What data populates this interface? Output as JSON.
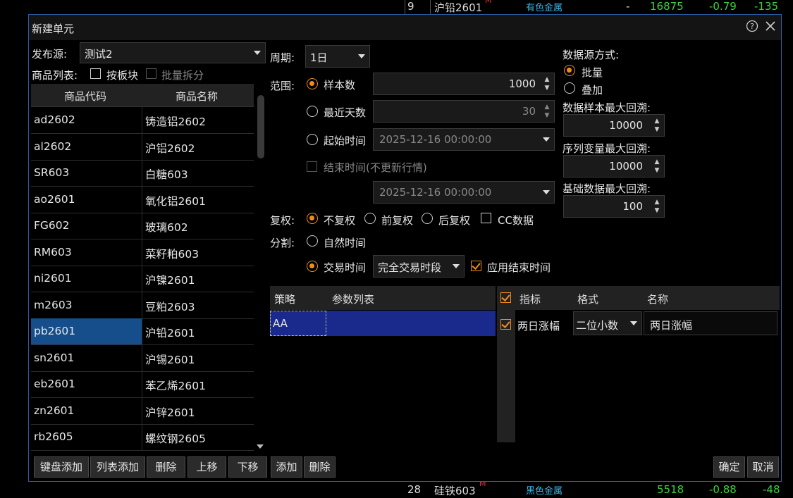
{
  "background_rows": [
    {
      "idx": "9",
      "name": "沪铅2601",
      "mark": "M",
      "sector": "有色金属",
      "c1": "-",
      "price": "16875",
      "chg_pct": "-0.79",
      "chg": "-135"
    },
    {
      "idx": "28",
      "name": "硅铁603",
      "mark": "M",
      "sector": "黑色金属",
      "c1": "",
      "price": "5518",
      "chg_pct": "-0.88",
      "chg": "-48"
    }
  ],
  "dialog": {
    "title": "新建单元",
    "help_icon": "help-icon",
    "close_icon": "close-icon"
  },
  "left": {
    "publish_label": "发布源:",
    "publish_value": "测试2",
    "product_list_label": "商品列表:",
    "by_sector_label": "按板块",
    "batch_split_label": "批量拆分",
    "columns": [
      "商品代码",
      "商品名称"
    ],
    "rows": [
      {
        "code": "ad2602",
        "name": "铸造铝2602"
      },
      {
        "code": "al2602",
        "name": "沪铝2602"
      },
      {
        "code": "SR603",
        "name": "白糖603"
      },
      {
        "code": "ao2601",
        "name": "氧化铝2601"
      },
      {
        "code": "FG602",
        "name": "玻璃602"
      },
      {
        "code": "RM603",
        "name": "菜籽粕603"
      },
      {
        "code": "ni2601",
        "name": "沪镍2601"
      },
      {
        "code": "m2603",
        "name": "豆粕2603"
      },
      {
        "code": "pb2601",
        "name": "沪铅2601"
      },
      {
        "code": "sn2601",
        "name": "沪锡2601"
      },
      {
        "code": "eb2601",
        "name": "苯乙烯2601"
      },
      {
        "code": "zn2601",
        "name": "沪锌2601"
      },
      {
        "code": "rb2605",
        "name": "螺纹钢2605"
      }
    ],
    "selected_row": 8,
    "buttons": [
      "键盘添加",
      "列表添加",
      "删除",
      "上移",
      "下移"
    ]
  },
  "middle": {
    "period_label": "周期:",
    "period_value": "1日",
    "range_label": "范围:",
    "sample_label": "样本数",
    "sample_value": "1000",
    "recent_days_label": "最近天数",
    "recent_days_value": "30",
    "start_time_label": "起始时间",
    "start_time_value": "2025-12-16 00:00:00",
    "end_time_label": "结束时间(不更新行情)",
    "end_time_value": "2025-12-16 00:00:00",
    "adjust_label": "复权:",
    "adjust_options": [
      "不复权",
      "前复权",
      "后复权"
    ],
    "cc_label": "CC数据",
    "split_label": "分割:",
    "natural_time_label": "自然时间",
    "trading_time_label": "交易时间",
    "trading_session_value": "完全交易时段",
    "apply_end_time_label": "应用结束时间"
  },
  "right": {
    "source_mode_label": "数据源方式:",
    "batch_label": "批量",
    "overlay_label": "叠加",
    "sample_max_label": "数据样本最大回溯:",
    "sample_max_value": "10000",
    "series_max_label": "序列变量最大回溯:",
    "series_max_value": "10000",
    "base_max_label": "基础数据最大回溯:",
    "base_max_value": "100"
  },
  "strategy": {
    "col_strategy": "策略",
    "col_params": "参数列表",
    "row_name": "AA",
    "add_label": "添加",
    "delete_label": "删除"
  },
  "indicators": {
    "col_indicator": "指标",
    "col_format": "格式",
    "col_name": "名称",
    "row_indicator": "两日涨幅",
    "row_format": "二位小数",
    "row_name": "两日涨幅"
  },
  "footer": {
    "ok_label": "确定",
    "cancel_label": "取消"
  },
  "colors": {
    "accent": "#f08c1e",
    "selection": "#154e8a",
    "strategy_selection": "#1a2a8c",
    "green": "#3cd23c",
    "cyan": "#3ab4e6"
  }
}
